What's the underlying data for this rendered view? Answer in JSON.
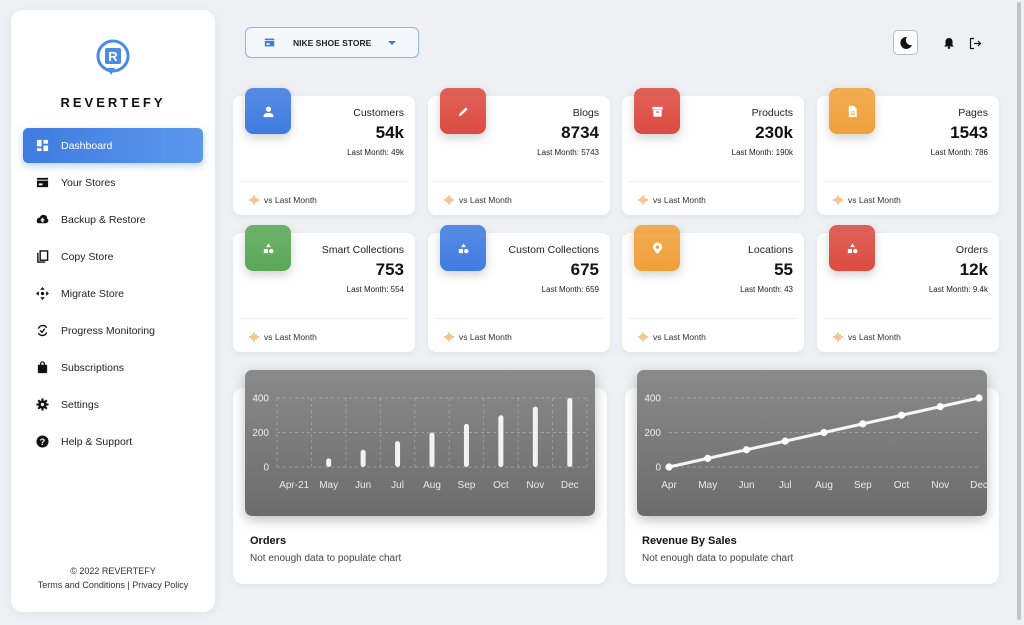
{
  "brand": {
    "name": "REVERTEFY"
  },
  "sidebar": {
    "items": [
      {
        "label": "Dashboard",
        "icon": "dashboard-icon",
        "active": true
      },
      {
        "label": "Your Stores",
        "icon": "store-icon"
      },
      {
        "label": "Backup & Restore",
        "icon": "cloud-upload-icon"
      },
      {
        "label": "Copy Store",
        "icon": "copy-icon"
      },
      {
        "label": "Migrate Store",
        "icon": "migrate-icon"
      },
      {
        "label": "Progress Monitoring",
        "icon": "progress-check-icon"
      },
      {
        "label": "Subscriptions",
        "icon": "shopping-bag-icon"
      },
      {
        "label": "Settings",
        "icon": "gear-icon"
      },
      {
        "label": "Help & Support",
        "icon": "help-icon"
      }
    ],
    "footer": {
      "copyright": "© 2022 REVERTEFY",
      "terms": "Terms and Conditions",
      "separator": " | ",
      "privacy": "Privacy Policy"
    }
  },
  "topbar": {
    "store_selector": {
      "label": "NIKE SHOE STORE",
      "icon": "store-icon"
    },
    "theme_toggle_icon": "moon-icon",
    "notifications_icon": "bell-icon",
    "logout_icon": "logout-icon"
  },
  "stats": [
    {
      "title": "Customers",
      "value": "54k",
      "last_month": "Last Month: 49k",
      "icon": "person-icon",
      "color": "#3f7be0",
      "footer": "vs Last Month"
    },
    {
      "title": "Blogs",
      "value": "8734",
      "last_month": "Last Month: 5743",
      "icon": "pencil-icon",
      "color": "#dc4b41",
      "footer": "vs Last Month"
    },
    {
      "title": "Products",
      "value": "230k",
      "last_month": "Last Month: 190k",
      "icon": "archive-icon",
      "color": "#dc4b41",
      "footer": "vs Last Month"
    },
    {
      "title": "Pages",
      "value": "1543",
      "last_month": "Last Month: 786",
      "icon": "document-icon",
      "color": "#f0a03a",
      "footer": "vs Last Month"
    },
    {
      "title": "Smart Collections",
      "value": "753",
      "last_month": "Last Month: 554",
      "icon": "shapes-icon",
      "color": "#5aa757",
      "footer": "vs Last Month"
    },
    {
      "title": "Custom Collections",
      "value": "675",
      "last_month": "Last Month: 659",
      "icon": "shapes-icon",
      "color": "#3f7be0",
      "footer": "vs Last Month"
    },
    {
      "title": "Locations",
      "value": "55",
      "last_month": "Last Month: 43",
      "icon": "location-pin-icon",
      "color": "#f0a03a",
      "footer": "vs Last Month"
    },
    {
      "title": "Orders",
      "value": "12k",
      "last_month": "Last Month: 9.4k",
      "icon": "shapes-icon",
      "color": "#dc4b41",
      "footer": "vs Last Month"
    }
  ],
  "chart_data": [
    {
      "type": "bar",
      "title": "Orders",
      "subtitle": "Not enough data to populate chart",
      "categories": [
        "Apr-21",
        "May",
        "Jun",
        "Jul",
        "Aug",
        "Sep",
        "Oct",
        "Nov",
        "Dec"
      ],
      "values": [
        0,
        50,
        100,
        150,
        200,
        250,
        300,
        350,
        400
      ],
      "yticks": [
        "0",
        "200",
        "400"
      ],
      "ylim": [
        0,
        400
      ],
      "grid": true,
      "xlabel": "",
      "ylabel": ""
    },
    {
      "type": "line",
      "title": "Revenue By Sales",
      "subtitle": "Not enough data to populate chart",
      "categories": [
        "Apr",
        "May",
        "Jun",
        "Jul",
        "Aug",
        "Sep",
        "Oct",
        "Nov",
        "Dec"
      ],
      "values": [
        0,
        50,
        100,
        150,
        200,
        250,
        300,
        350,
        400
      ],
      "yticks": [
        "0",
        "200",
        "400"
      ],
      "ylim": [
        0,
        400
      ],
      "grid": true,
      "xlabel": "",
      "ylabel": ""
    }
  ]
}
